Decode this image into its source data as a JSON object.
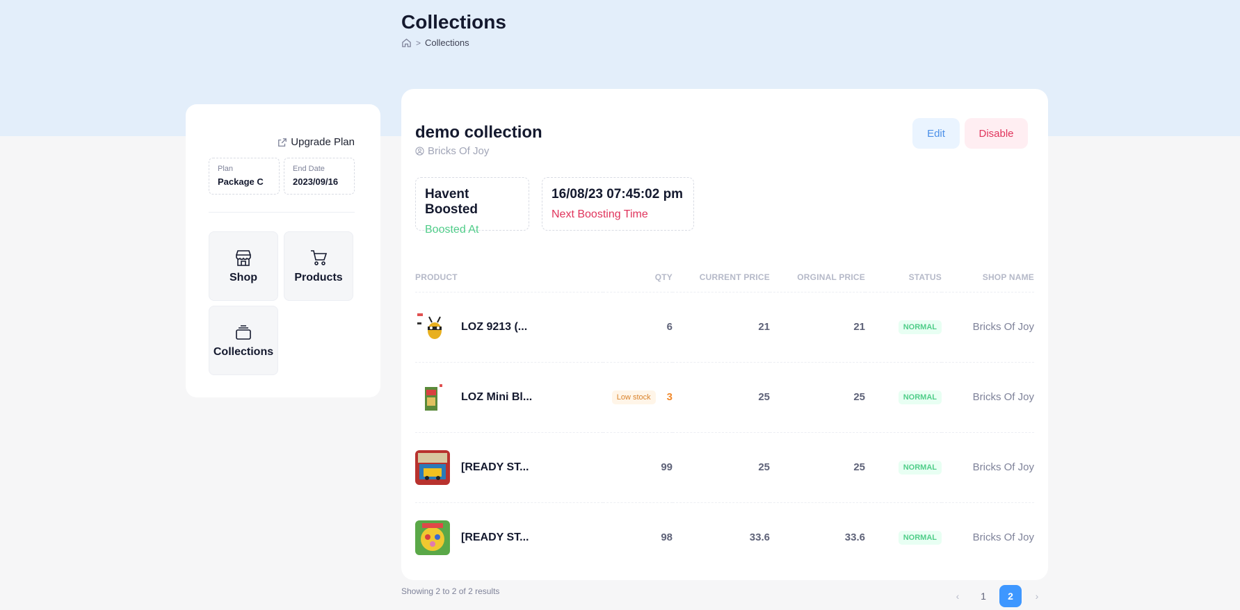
{
  "header": {
    "title": "Collections",
    "breadcrumb": {
      "icon": "home-icon",
      "separator": ">",
      "current": "Collections"
    }
  },
  "sidebar": {
    "upgrade_label": "Upgrade Plan",
    "plan": {
      "label": "Plan",
      "value": "Package C"
    },
    "end_date": {
      "label": "End Date",
      "value": "2023/09/16"
    },
    "nav": [
      {
        "label": "Shop",
        "icon": "shop-icon"
      },
      {
        "label": "Products",
        "icon": "cart-icon"
      },
      {
        "label": "Collections",
        "icon": "stack-icon"
      }
    ]
  },
  "collection": {
    "name": "demo collection",
    "owner": "Bricks Of Joy",
    "edit_label": "Edit",
    "disable_label": "Disable",
    "boosted": {
      "value": "Havent Boosted",
      "label": "Boosted At"
    },
    "next_boost": {
      "value": "16/08/23 07:45:02 pm",
      "label": "Next Boosting Time"
    }
  },
  "table": {
    "columns": [
      "Product",
      "QTY",
      "Current Price",
      "Orginal Price",
      "Status",
      "Shop Name"
    ],
    "rows": [
      {
        "name": "LOZ 9213 (...",
        "qty": "6",
        "low_stock": "",
        "current_price": "21",
        "original_price": "21",
        "status": "NORMAL",
        "shop": "Bricks Of Joy"
      },
      {
        "name": "LOZ Mini Bl...",
        "qty": "3",
        "low_stock": "Low stock",
        "current_price": "25",
        "original_price": "25",
        "status": "NORMAL",
        "shop": "Bricks Of Joy"
      },
      {
        "name": "[READY ST...",
        "qty": "99",
        "low_stock": "",
        "current_price": "25",
        "original_price": "25",
        "status": "NORMAL",
        "shop": "Bricks Of Joy"
      },
      {
        "name": "[READY ST...",
        "qty": "98",
        "low_stock": "",
        "current_price": "33.6",
        "original_price": "33.6",
        "status": "NORMAL",
        "shop": "Bricks Of Joy"
      }
    ]
  },
  "footer": {
    "showing": "Showing 2 to 2 of 2 results",
    "prev": "‹",
    "pages": [
      "1",
      "2"
    ],
    "current_page": "2",
    "next": "›"
  },
  "colors": {
    "accent": "#3e97ff",
    "success": "#50cd89",
    "danger": "#e0345c",
    "warning": "#f1892b",
    "hero_bg": "#e3eefa"
  }
}
